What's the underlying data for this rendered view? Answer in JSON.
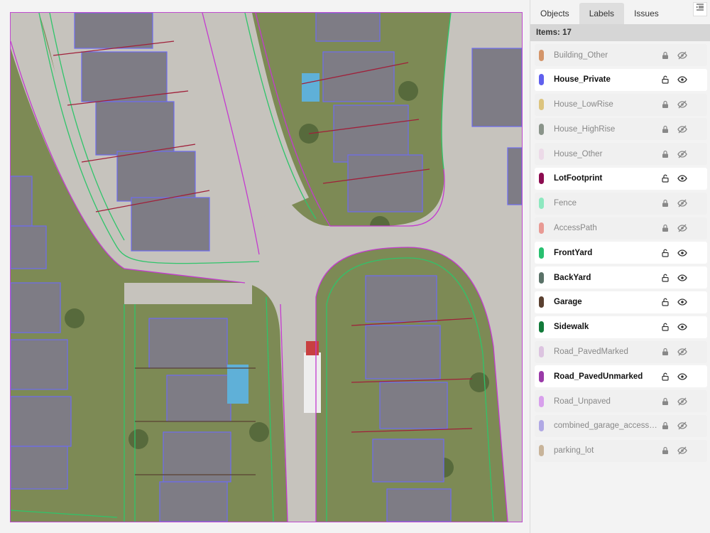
{
  "panel": {
    "tabs": [
      {
        "label": "Objects",
        "active": false
      },
      {
        "label": "Labels",
        "active": true
      },
      {
        "label": "Issues",
        "active": false
      }
    ],
    "collapse_icon": "collapse-panel-icon",
    "items_count": "Items: 17"
  },
  "labels": [
    {
      "name": "Building_Other",
      "color": "#d4956a",
      "visible": false
    },
    {
      "name": "House_Private",
      "color": "#6060ee",
      "visible": true
    },
    {
      "name": "House_LowRise",
      "color": "#dcc47e",
      "visible": false
    },
    {
      "name": "House_HighRise",
      "color": "#8a948a",
      "visible": false
    },
    {
      "name": "House_Other",
      "color": "#ecdae8",
      "visible": false
    },
    {
      "name": "LotFootprint",
      "color": "#8c0c50",
      "visible": true
    },
    {
      "name": "Fence",
      "color": "#8ee8c0",
      "visible": false
    },
    {
      "name": "AccessPath",
      "color": "#e89a94",
      "visible": false
    },
    {
      "name": "FrontYard",
      "color": "#28c070",
      "visible": true
    },
    {
      "name": "BackYard",
      "color": "#5a7268",
      "visible": true
    },
    {
      "name": "Garage",
      "color": "#5a4030",
      "visible": true
    },
    {
      "name": "Sidewalk",
      "color": "#127a3a",
      "visible": true
    },
    {
      "name": "Road_PavedMarked",
      "color": "#dcc4e0",
      "visible": false
    },
    {
      "name": "Road_PavedUnmarked",
      "color": "#9a3aa8",
      "visible": true
    },
    {
      "name": "Road_Unpaved",
      "color": "#d8a0ec",
      "visible": false
    },
    {
      "name": "combined_garage_access_p...",
      "color": "#b0a8e4",
      "visible": false
    },
    {
      "name": "parking_lot",
      "color": "#c8b49a",
      "visible": false
    }
  ]
}
